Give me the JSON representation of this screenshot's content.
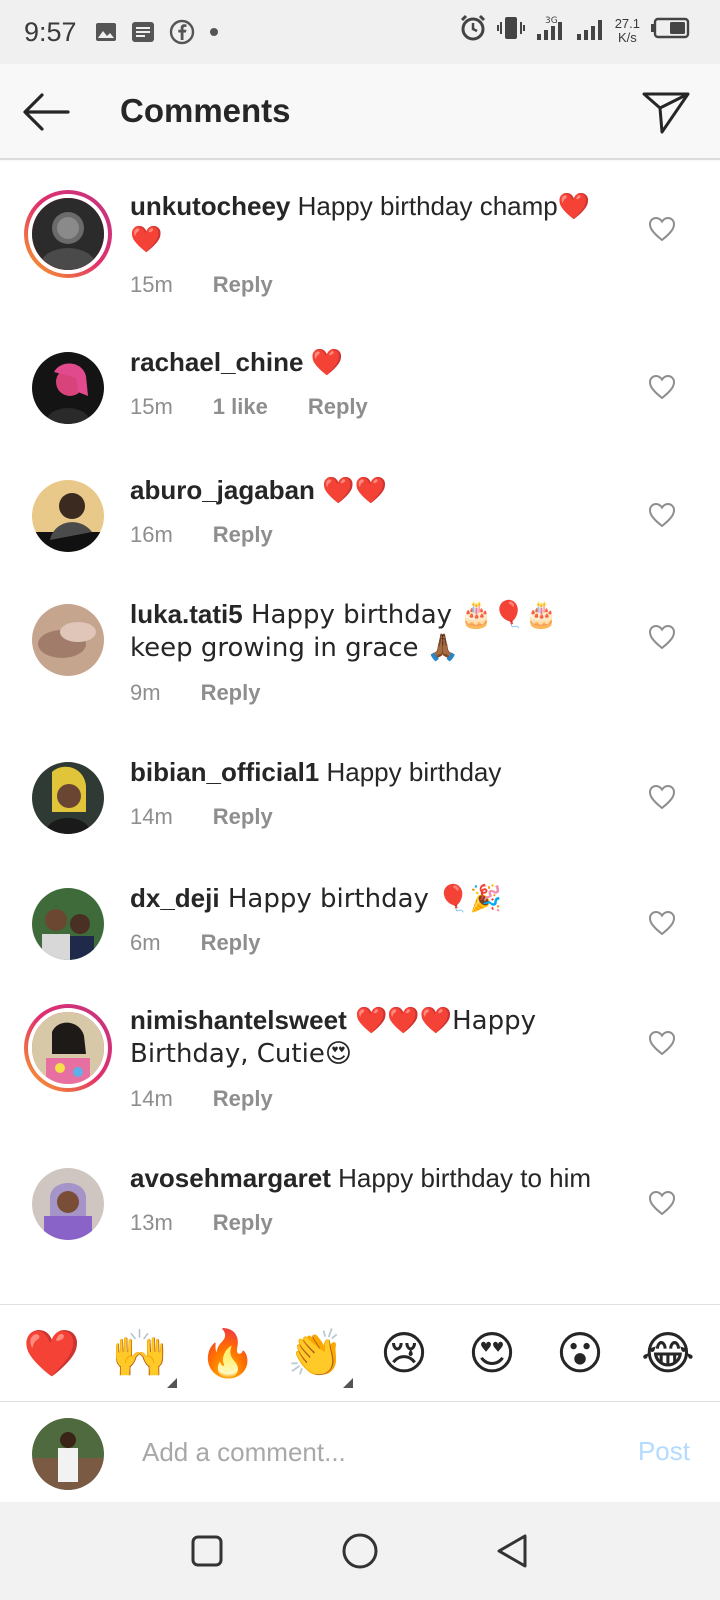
{
  "status_bar": {
    "time": "9:57",
    "net_speed_value": "27.1",
    "net_speed_unit": "K/s",
    "network_type": "3G"
  },
  "header": {
    "title": "Comments"
  },
  "comments": [
    {
      "username": "unkutocheey",
      "text": " Happy birthday champ",
      "emoji": "❤️❤️",
      "time": "15m",
      "likes": "",
      "reply_label": "Reply",
      "story_ring": true
    },
    {
      "username": "rachael_chine",
      "text": " ",
      "emoji": "❤️",
      "time": "15m",
      "likes": "1 like",
      "reply_label": "Reply",
      "story_ring": false
    },
    {
      "username": "aburo_jagaban",
      "text": " ",
      "emoji": "❤️❤️",
      "time": "16m",
      "likes": "",
      "reply_label": "Reply",
      "story_ring": false
    },
    {
      "username": "luka.tati5",
      "text": " Happy birthday 🎂🎈🎂 keep growing in grace 🙏🏾",
      "emoji": "",
      "time": "9m",
      "likes": "",
      "reply_label": "Reply",
      "story_ring": false
    },
    {
      "username": "bibian_official1",
      "text": " Happy birthday",
      "emoji": "",
      "time": "14m",
      "likes": "",
      "reply_label": "Reply",
      "story_ring": false
    },
    {
      "username": "dx_deji",
      "text": " Happy birthday 🎈🎉",
      "emoji": "",
      "time": "6m",
      "likes": "",
      "reply_label": "Reply",
      "story_ring": false
    },
    {
      "username": "nimishantelsweet",
      "text": " ❤️❤️❤️Happy Birthday, Cutie😍",
      "emoji": "",
      "time": "14m",
      "likes": "",
      "reply_label": "Reply",
      "story_ring": true
    },
    {
      "username": "avosehmargaret",
      "text": " Happy birthday to him",
      "emoji": "",
      "time": "13m",
      "likes": "",
      "reply_label": "Reply",
      "story_ring": false
    }
  ],
  "reactions": [
    "❤️",
    "🙌",
    "🔥",
    "👏",
    "😢",
    "😍",
    "😮",
    "😂"
  ],
  "composer": {
    "placeholder": "Add a comment...",
    "post_label": "Post"
  },
  "colors": {
    "heart": "#e0142e",
    "post_disabled": "#b3dbff",
    "story_ring_start": "#f9a825",
    "story_ring_end": "#c13584"
  }
}
